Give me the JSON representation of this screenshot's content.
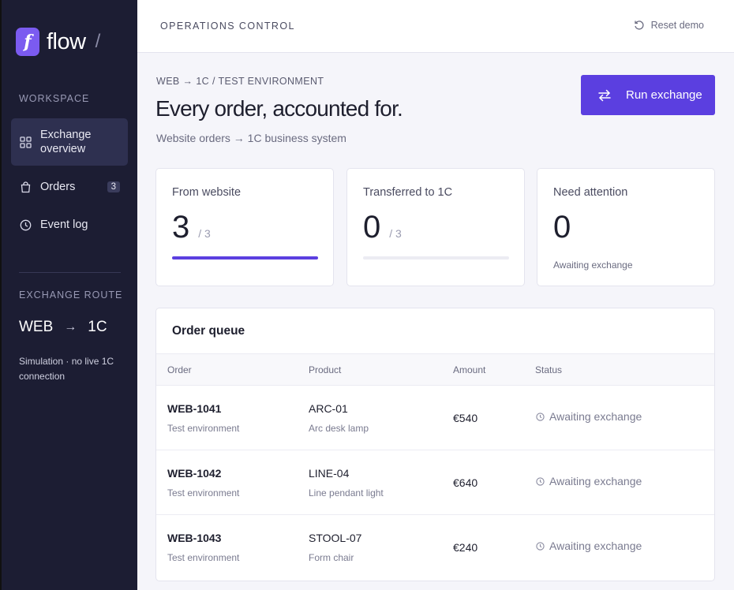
{
  "sidebar": {
    "logo_mark": "f",
    "brand": "flow",
    "brand_slash": "/",
    "workspace_heading": "WORKSPACE",
    "nav": [
      {
        "label": "Exchange overview",
        "icon": "grid-icon",
        "active": true
      },
      {
        "label": "Orders",
        "icon": "bag-icon",
        "badge": "3"
      },
      {
        "label": "Event log",
        "icon": "clock-icon"
      }
    ],
    "route_heading": "EXCHANGE ROUTE",
    "route_from": "WEB",
    "route_arrow": "→",
    "route_to": "1C",
    "sim_note": "Simulation · no live 1C connection"
  },
  "topbar": {
    "title": "OPERATIONS CONTROL",
    "reset_label": "Reset demo"
  },
  "main": {
    "breadcrumb": "WEB → 1C / TEST ENVIRONMENT",
    "headline": "Every order, accounted for.",
    "subline": "Website orders → 1C business system",
    "run_button": "Run exchange"
  },
  "stats": [
    {
      "label": "From website",
      "value": "3",
      "of": "/ 3",
      "progress": 1.0
    },
    {
      "label": "Transferred to 1C",
      "value": "0",
      "of": "/ 3",
      "progress": 0.0
    },
    {
      "label": "Need attention",
      "value": "0",
      "note": "Awaiting exchange"
    }
  ],
  "queue": {
    "title": "Order queue",
    "columns": [
      "Order",
      "Product",
      "Amount",
      "Status"
    ],
    "rows": [
      {
        "order": "WEB-1041",
        "env": "Test environment",
        "sku": "ARC-01",
        "product": "Arc desk lamp",
        "amount": "€540",
        "status": "Awaiting exchange"
      },
      {
        "order": "WEB-1042",
        "env": "Test environment",
        "sku": "LINE-04",
        "product": "Line pendant light",
        "amount": "€640",
        "status": "Awaiting exchange"
      },
      {
        "order": "WEB-1043",
        "env": "Test environment",
        "sku": "STOOL-07",
        "product": "Form chair",
        "amount": "€240",
        "status": "Awaiting exchange"
      }
    ]
  },
  "colors": {
    "sidebar_bg": "#1c1d33",
    "accent": "#5b3fe0",
    "logo": "#7b5bf0",
    "page_bg": "#f5f5fa"
  }
}
